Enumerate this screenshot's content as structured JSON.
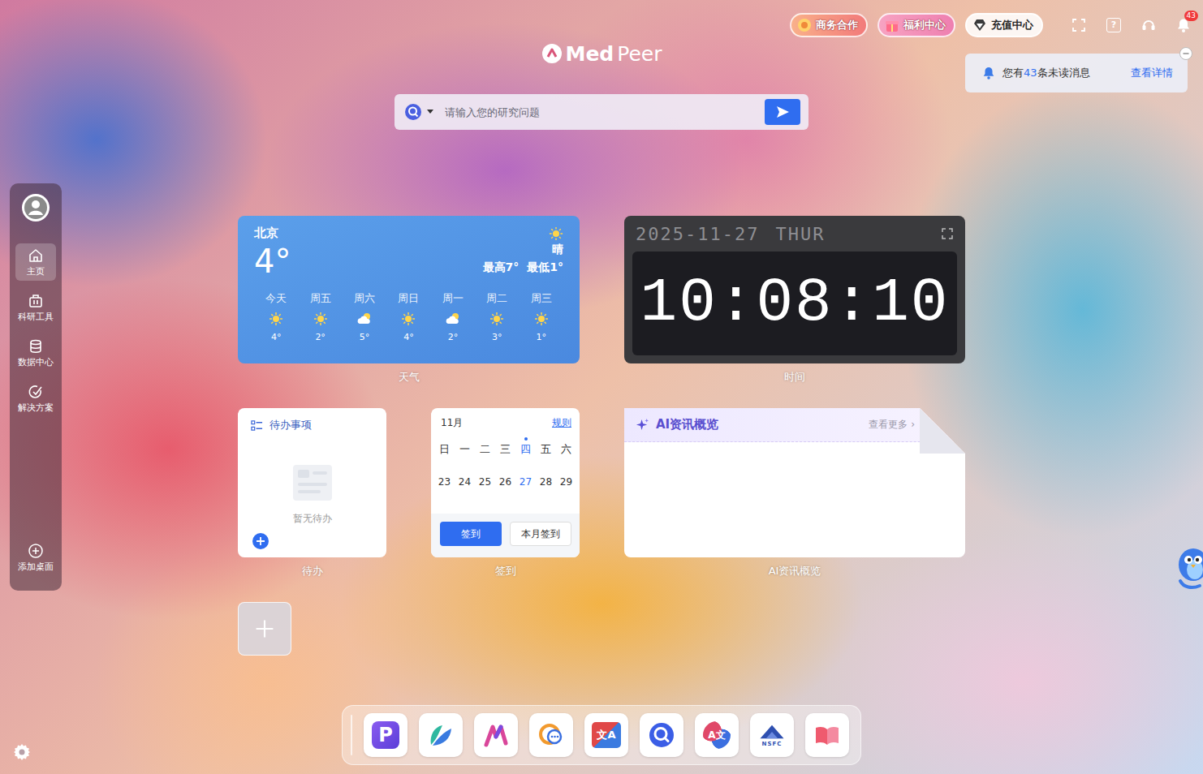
{
  "top_bar": {
    "buttons": [
      {
        "label": "商务合作",
        "kind": "business"
      },
      {
        "label": "福利中心",
        "kind": "welfare"
      },
      {
        "label": "充值中心",
        "kind": "recharge"
      }
    ],
    "icons": [
      {
        "kind": "fullscreen",
        "glyph": ""
      },
      {
        "kind": "help",
        "glyph": "?"
      },
      {
        "kind": "support",
        "glyph": ""
      },
      {
        "kind": "bell",
        "glyph": ""
      }
    ],
    "bell_badge": "43"
  },
  "logo": {
    "bold": "Med",
    "light": "Peer"
  },
  "search": {
    "placeholder": "请输入您的研究问题"
  },
  "notification": {
    "prefix": "您有",
    "count": "43",
    "suffix": "条未读消息",
    "link": "查看详情"
  },
  "sidebar": {
    "items": [
      {
        "label": "主页",
        "kind": "home",
        "selected": true
      },
      {
        "label": "科研工具",
        "kind": "tools",
        "selected": false
      },
      {
        "label": "数据中心",
        "kind": "data",
        "selected": false
      },
      {
        "label": "解决方案",
        "kind": "solutions",
        "selected": false
      }
    ],
    "add": "添加桌面"
  },
  "weather": {
    "city": "北京",
    "temp": "4°",
    "condition": "晴",
    "high": "最高7°",
    "low": "最低1°",
    "days": [
      {
        "label": "今天",
        "temp": "4°",
        "kind": "sunny"
      },
      {
        "label": "周五",
        "temp": "2°",
        "kind": "sunny"
      },
      {
        "label": "周六",
        "temp": "5°",
        "kind": "cloudy"
      },
      {
        "label": "周日",
        "temp": "4°",
        "kind": "sunny"
      },
      {
        "label": "周一",
        "temp": "2°",
        "kind": "cloudy"
      },
      {
        "label": "周二",
        "temp": "3°",
        "kind": "sunny"
      },
      {
        "label": "周三",
        "temp": "1°",
        "kind": "sunny"
      }
    ],
    "caption": "天气"
  },
  "clock": {
    "date": "2025-11-27",
    "weekday": "THUR",
    "time": "10:08:10",
    "caption": "时间"
  },
  "todo": {
    "title": "待办事项",
    "empty": "暂无待办",
    "caption": "待办"
  },
  "calendar": {
    "month": "11月",
    "rule_link": "规则",
    "weekdays": [
      {
        "label": "日",
        "selected": false
      },
      {
        "label": "一",
        "selected": false
      },
      {
        "label": "二",
        "selected": false
      },
      {
        "label": "三",
        "selected": false
      },
      {
        "label": "四",
        "selected": true
      },
      {
        "label": "五",
        "selected": false
      },
      {
        "label": "六",
        "selected": false
      }
    ],
    "dates": [
      {
        "label": "23",
        "selected": false
      },
      {
        "label": "24",
        "selected": false
      },
      {
        "label": "25",
        "selected": false
      },
      {
        "label": "26",
        "selected": false
      },
      {
        "label": "27",
        "selected": true
      },
      {
        "label": "28",
        "selected": false
      },
      {
        "label": "29",
        "selected": false
      }
    ],
    "buttons": [
      {
        "label": "签到",
        "kind": "primary"
      },
      {
        "label": "本月签到",
        "kind": "secondary"
      }
    ],
    "caption": "签到"
  },
  "ai_news": {
    "title": "AI资讯概览",
    "more": "查看更多",
    "chevron": "›",
    "caption": "AI资讯概览"
  },
  "dock": [
    {
      "kind": "pen",
      "glyph": "P"
    },
    {
      "kind": "leaf",
      "glyph": ""
    },
    {
      "kind": "stroke",
      "glyph": ""
    },
    {
      "kind": "chat",
      "glyph": ""
    },
    {
      "kind": "translate",
      "glyph": "文A"
    },
    {
      "kind": "search",
      "glyph": ""
    },
    {
      "kind": "translate2",
      "glyph": "A文"
    },
    {
      "kind": "nsfc",
      "glyph": "NSFC"
    },
    {
      "kind": "book",
      "glyph": ""
    }
  ]
}
